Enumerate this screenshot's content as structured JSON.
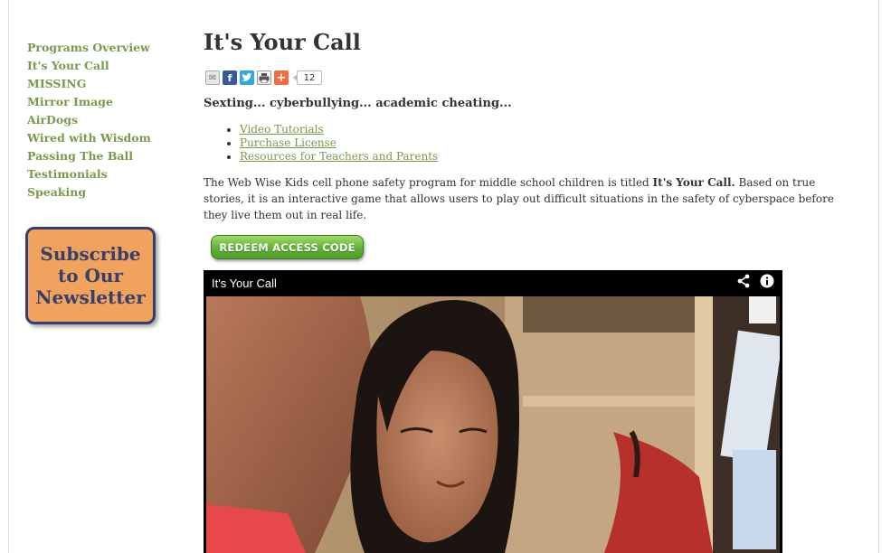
{
  "sidebar": {
    "items": [
      {
        "label": "Programs Overview"
      },
      {
        "label": "It's Your Call"
      },
      {
        "label": "MISSING"
      },
      {
        "label": "Mirror Image"
      },
      {
        "label": "AirDogs"
      },
      {
        "label": "Wired with Wisdom"
      },
      {
        "label": "Passing The Ball"
      },
      {
        "label": "Testimonials"
      },
      {
        "label": "Speaking"
      }
    ],
    "subscribe": {
      "line1": "Subscribe",
      "line2": "to Our",
      "line3": "Newsletter"
    }
  },
  "main": {
    "title": "It's Your Call",
    "share": {
      "count": "12"
    },
    "tagline": "Sexting... cyberbullying... academic cheating...",
    "links": [
      {
        "label": "Video Tutorials"
      },
      {
        "label": "Purchase License"
      },
      {
        "label": "Resources for Teachers and Parents"
      }
    ],
    "description": {
      "part1": "The Web Wise Kids cell phone safety program for middle school children is titled ",
      "bold": "It's Your Call.",
      "part2": " Based on true stories, it is an interactive game that allows users to play out difficult situations in the safety of cyberspace before they live them out in real life."
    },
    "redeem_label": "REDEEM ACCESS CODE",
    "video": {
      "title": "It's Your Call"
    }
  },
  "colors": {
    "nav_green": "#7a9a4a",
    "subscribe_bg": "#f1a25c",
    "subscribe_text": "#35406e",
    "redeem_green": "#5fb236"
  },
  "icons": {
    "share_bar": [
      "email-icon",
      "facebook-icon",
      "twitter-icon",
      "print-icon",
      "addthis-plus-icon"
    ],
    "video": [
      "share-icon",
      "info-icon"
    ]
  }
}
